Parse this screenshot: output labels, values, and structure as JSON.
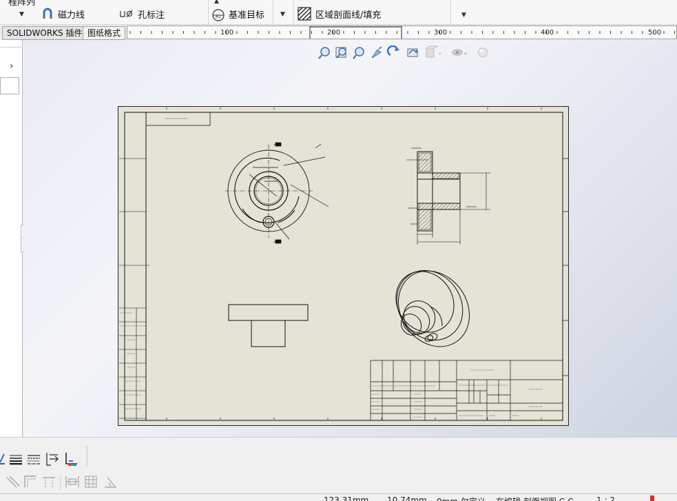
{
  "ribbon": {
    "top_cut_label": "程阵列",
    "magnet_line_label": "磁力线",
    "hole_callout_label": "孔标注",
    "datum_target_label": "基准目标",
    "area_hatch_label": "区域剖面线/填充"
  },
  "tabs": [
    {
      "label": "SOLIDWORKS 插件"
    },
    {
      "label": "图纸格式"
    }
  ],
  "ruler": {
    "ticks": [
      "100",
      "200",
      "300",
      "400",
      "500"
    ]
  },
  "statusbar": {
    "x_coord": "123.31mm",
    "y_coord": "10.74mm",
    "z_status": "0mm 欠定义",
    "edit_state": "在编辑 剖面视图 C-C",
    "scale": "1 : 2"
  },
  "hud_icons": [
    "zoom-to-fit-icon",
    "zoom-area-icon",
    "zoom-in-out-icon",
    "pan-icon",
    "rotate-icon",
    "redraw-icon",
    "display-style-icon",
    "hide-show-icon",
    "appearance-icon"
  ],
  "bottom_icons_row1": [
    "line-format-icon",
    "line-weight-icon",
    "line-style-icon",
    "hide-edge-icon",
    "color-display-icon"
  ],
  "bottom_icons_row2": [
    "dim-line-icon",
    "dim-angle-icon",
    "dim-baseline-icon",
    "dim-chain-icon",
    "dim-grid-icon",
    "dim-angular-icon"
  ],
  "colors": {
    "sheet": "#e4e3d6",
    "ink": "#111111",
    "accent_blue": "#2e6fd1"
  }
}
